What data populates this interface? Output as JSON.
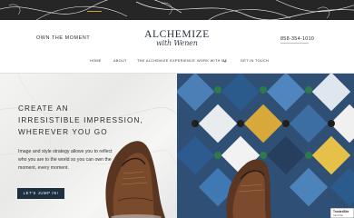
{
  "header": {
    "tagline": "OWN THE MOMENT",
    "logo_main": "ALCHEMIZE",
    "logo_script": "with Wenen",
    "phone": "858-354-1010"
  },
  "nav": {
    "items": [
      {
        "label": "HOME",
        "active": true
      },
      {
        "label": "ABOUT",
        "active": false
      },
      {
        "label": "THE ALCHEMIZE EXPERIENCE",
        "active": false
      },
      {
        "label": "WORK WITH ME",
        "active": false,
        "has_dropdown": true
      },
      {
        "label": "GET IN TOUCH",
        "active": false
      }
    ]
  },
  "hero": {
    "headline_lines": [
      "CREATE AN",
      "IRRESISTIBLE IMPRESSION,",
      "WHEREVER YOU GO"
    ],
    "body": "Image and style strategy allows you to reflect who you are to the world so you can own the moment, every moment.",
    "cta_label": "LET'S JUMP IN!"
  },
  "badge": {
    "title": "TrustedSite",
    "subtitle": "SECURE"
  },
  "colors": {
    "accent": "#c9a23a",
    "button": "#1e2f40",
    "band": "#262626"
  }
}
